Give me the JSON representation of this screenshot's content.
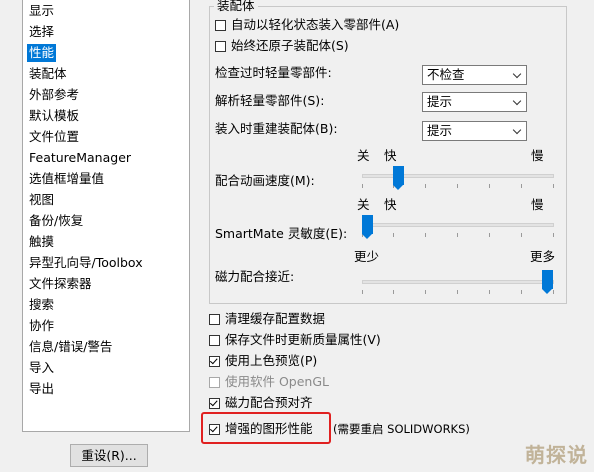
{
  "sidebar": {
    "items": [
      {
        "label": "显示"
      },
      {
        "label": "选择"
      },
      {
        "label": "性能",
        "selected": true
      },
      {
        "label": "装配体"
      },
      {
        "label": "外部参考"
      },
      {
        "label": "默认模板"
      },
      {
        "label": "文件位置"
      },
      {
        "label": "FeatureManager"
      },
      {
        "label": "选值框增量值"
      },
      {
        "label": "视图"
      },
      {
        "label": "备份/恢复"
      },
      {
        "label": "触摸"
      },
      {
        "label": "异型孔向导/Toolbox"
      },
      {
        "label": "文件探索器"
      },
      {
        "label": "搜索"
      },
      {
        "label": "协作"
      },
      {
        "label": "信息/错误/警告"
      },
      {
        "label": "导入"
      },
      {
        "label": "导出"
      }
    ],
    "reset_label": "重设(R)..."
  },
  "assembly": {
    "group_title": "装配体",
    "auto_lightweight": {
      "label": "自动以轻化状态装入零部件(A)",
      "checked": false
    },
    "always_resolve": {
      "label": "始终还原子装配体(S)",
      "checked": false
    },
    "check_outdated": {
      "label": "检查过时轻量零部件:",
      "value": "不检查"
    },
    "resolve_lightweight": {
      "label": "解析轻量零部件(S):",
      "value": "提示"
    },
    "rebuild_on_load": {
      "label": "装入时重建装配体(B):",
      "value": "提示"
    },
    "mate_speed": {
      "label": "配合动画速度(M):",
      "scale_off": "关",
      "scale_fast": "快",
      "scale_slow": "慢",
      "level": 0.15
    },
    "smartmate": {
      "label": "SmartMate 灵敏度(E):",
      "scale_off": "关",
      "scale_fast": "快",
      "scale_slow": "慢",
      "level": 0.0
    },
    "magnetic_mate": {
      "label": "磁力配合接近:",
      "scale_less": "更少",
      "scale_more": "更多",
      "level": 1.0
    }
  },
  "options": {
    "purge_cache": {
      "label": "清理缓存配置数据",
      "checked": false
    },
    "save_update_mass": {
      "label": "保存文件时更新质量属性(V)",
      "checked": false
    },
    "shaded_preview": {
      "label": "使用上色预览(P)",
      "checked": true
    },
    "software_opengl": {
      "label": "使用软件 OpenGL",
      "checked": false,
      "disabled": true
    },
    "magnetic_prealign": {
      "label": "磁力配合预对齐",
      "checked": true
    },
    "enhanced_graphics": {
      "label": "增强的图形性能",
      "checked": true
    },
    "restart_note": "(需要重启 SOLIDWORKS)"
  },
  "watermark": "萌探说",
  "colors": {
    "selection": "#0078d7",
    "highlight": "#e02020"
  }
}
